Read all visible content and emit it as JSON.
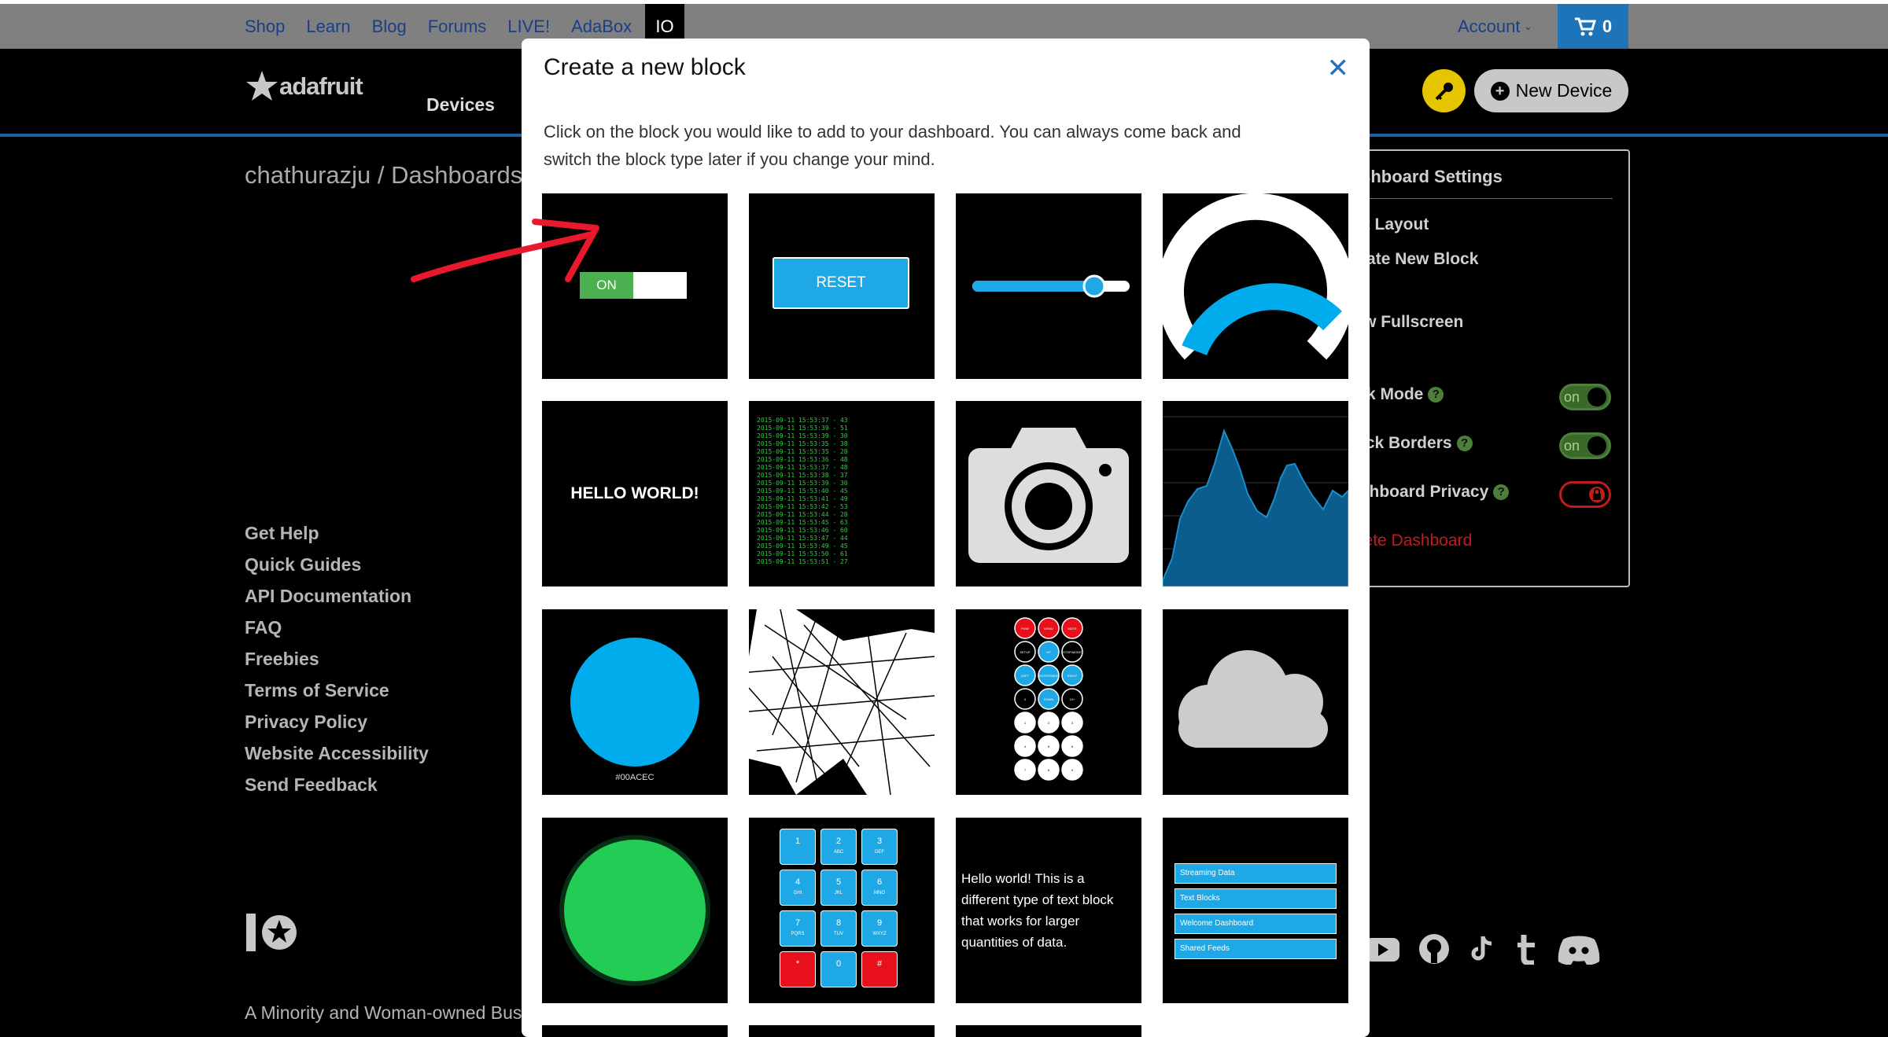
{
  "topnav": {
    "links": [
      "Shop",
      "Learn",
      "Blog",
      "Forums",
      "LIVE!",
      "AdaBox"
    ],
    "io_tab": "IO",
    "account": "Account",
    "cart_count": "0"
  },
  "header": {
    "logo_text": "adafruit",
    "nav_devices": "Devices",
    "new_device": "New Device"
  },
  "breadcrumb": "chathurazju / Dashboards",
  "footer": {
    "links": [
      "Get Help",
      "Quick Guides",
      "API Documentation",
      "FAQ",
      "Freebies",
      "Terms of Service",
      "Privacy Policy",
      "Website Accessibility",
      "Send Feedback"
    ],
    "minority": "A Minority and Woman-owned Business"
  },
  "settings": {
    "title": "Dashboard Settings",
    "edit_layout": "Edit Layout",
    "create_block": "Create New Block",
    "fullscreen": "View Fullscreen",
    "dark_mode": "Dark Mode",
    "block_borders": "Block Borders",
    "privacy": "Dashboard Privacy",
    "delete": "Delete Dashboard",
    "toggle_on": "on"
  },
  "modal": {
    "title": "Create a new block",
    "description_line1": "Click on the block you would like to add to your dashboard. You can always come back and",
    "description_line2": "switch the block type later if you change your mind."
  },
  "blocks": {
    "toggle_on": "ON",
    "reset": "RESET",
    "hello_world": "HELLO WORLD!",
    "color_hex": "#00ACEC",
    "stream_lines": [
      "2015-09-11 15:53:37 - 43",
      "2015-09-11 15:53:39 - 51",
      "2015-09-11 15:53:39 - 30",
      "2015-09-11 15:53:35 - 38",
      "2015-09-11 15:53:35 - 28",
      "2015-09-11 15:53:36 - 48",
      "2015-09-11 15:53:37 - 48",
      "2015-09-11 15:53:38 - 37",
      "2015-09-11 15:53:39 - 30",
      "2015-09-11 15:53:40 - 45",
      "2015-09-11 15:53:41 - 49",
      "2015-09-11 15:53:42 - 53",
      "2015-09-11 15:53:44 - 28",
      "2015-09-11 15:53:45 - 63",
      "2015-09-11 15:53:46 - 60",
      "2015-09-11 15:53:47 - 44",
      "2015-09-11 15:53:49 - 45",
      "2015-09-11 15:53:50 - 61",
      "2015-09-11 15:53:51 - 27"
    ],
    "remote_top": [
      "POW",
      "MENU",
      "MUTE"
    ],
    "remote_mid": [
      "SETUP",
      "UP",
      "STOP/MODE"
    ],
    "remote_row3": [
      "LEFT",
      "ENTER/SAVE",
      "RIGHT"
    ],
    "remote_row4": [
      "0",
      "DOWN",
      "10+"
    ],
    "remote_nums": [
      "1",
      "2",
      "3",
      "4",
      "5",
      "6",
      "7",
      "8",
      "9"
    ],
    "keypad_digits": [
      "1",
      "2",
      "3",
      "4",
      "5",
      "6",
      "7",
      "8",
      "9",
      "*",
      "0",
      "#"
    ],
    "keypad_letters": [
      "",
      "ABC",
      "DEF",
      "GHI",
      "JKL",
      "MNO",
      "PQRS",
      "TUV",
      "WXYZ",
      "",
      "",
      ""
    ],
    "text_block": [
      "Hello world! This is a",
      "different type of text block",
      "that works for larger",
      "quantities of data."
    ],
    "list_items": [
      "Streaming Data",
      "Text Blocks",
      "Welcome Dashboard",
      "Shared Feeds"
    ]
  },
  "colors": {
    "accent_blue": "#00acec",
    "green": "#22cc55",
    "red": "#e8101a",
    "annotation_red": "#e8192c"
  }
}
